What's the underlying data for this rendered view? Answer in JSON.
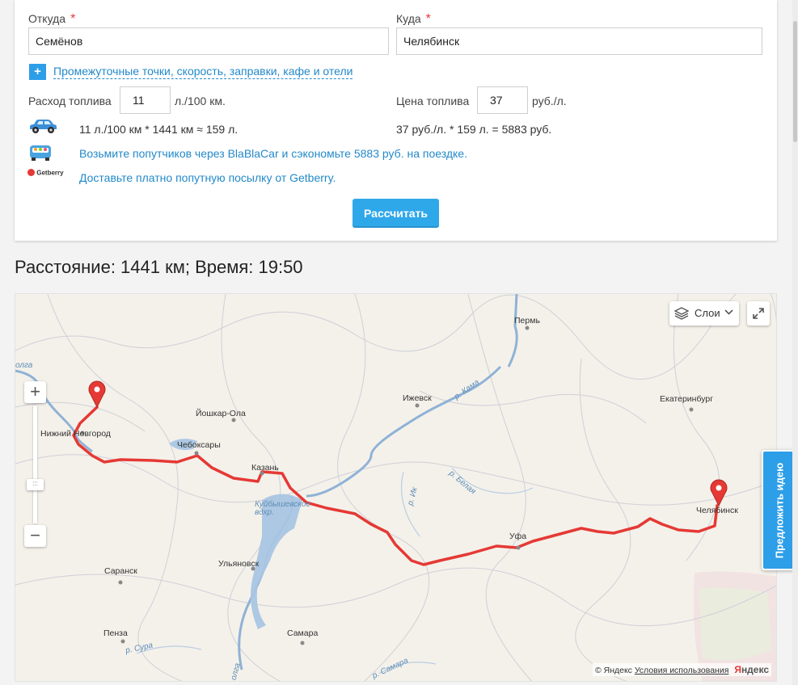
{
  "form": {
    "from_label": "Откуда",
    "from_value": "Семёнов",
    "to_label": "Куда",
    "to_value": "Челябинск",
    "required_mark": "*",
    "add_icon": "+",
    "waypoints_link": "Промежуточные точки, скорость, заправки, кафе и отели",
    "consumption_label": "Расход топлива",
    "consumption_value": "11",
    "consumption_unit": "л./100 км.",
    "price_label": "Цена топлива",
    "price_value": "37",
    "price_unit": "руб./л.",
    "calc_fuel": "11 л./100 км * 1441 км ≈ 159 л.",
    "calc_cost": "37 руб./л. * 159 л. = 5883 руб.",
    "blablacar_text": "Возьмите попутчиков через BlaBlaCar и сэкономьте 5883 руб. на поездке.",
    "getberry_logo": "Getberry",
    "getberry_text": "Доставьте платно попутную посылку от Getberry.",
    "calculate_button": "Рассчитать"
  },
  "result": {
    "summary": "Расстояние: 1441 км; Время: 19:50"
  },
  "map": {
    "layers_label": "Слои",
    "zoom_in": "+",
    "zoom_out": "−",
    "zoom_thumb": ":::",
    "copyright": "© Яндекс",
    "terms_link": "Условия использования",
    "logo_ya": "Я",
    "logo_rest": "ндекс",
    "route_color": "#e53935",
    "cities": [
      {
        "name": "Нижний Новгород"
      },
      {
        "name": "Йошкар-Ола"
      },
      {
        "name": "Чебоксары"
      },
      {
        "name": "Казань"
      },
      {
        "name": "Пермь"
      },
      {
        "name": "Ижевск"
      },
      {
        "name": "Екатеринбург"
      },
      {
        "name": "Челябинск"
      },
      {
        "name": "Уфа"
      },
      {
        "name": "Ульяновск"
      },
      {
        "name": "Саранск"
      },
      {
        "name": "Пенза"
      },
      {
        "name": "Самара"
      }
    ],
    "rivers": [
      {
        "name": "олга"
      },
      {
        "name": "р. Кама"
      },
      {
        "name": "р. Белая"
      },
      {
        "name": "р. Ик"
      },
      {
        "name": "Куйбышевское вдхр."
      },
      {
        "name": "р. Сура"
      },
      {
        "name": "р. Самара"
      },
      {
        "name": "олга"
      }
    ]
  },
  "side": {
    "idea_button": "Предложить идею"
  }
}
